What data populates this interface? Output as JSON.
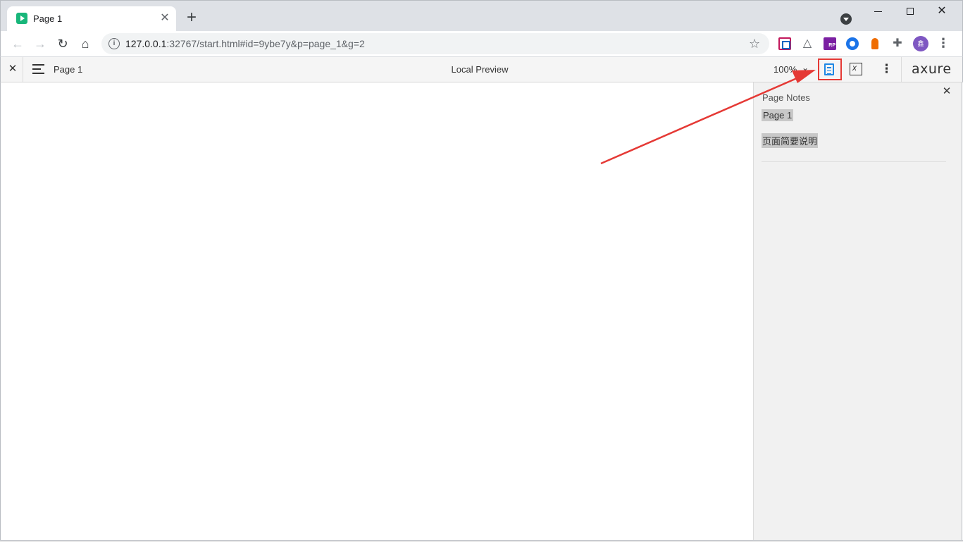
{
  "browser": {
    "tab": {
      "title": "Page 1",
      "close": "✕"
    },
    "new_tab": "+",
    "url": {
      "host": "127.0.0.1",
      "rest": ":32767/start.html#id=9ybe7y&p=page_1&g=2"
    },
    "window": {
      "close": "✕"
    },
    "avatar_initial": "鑫"
  },
  "axure": {
    "close": "✕",
    "page_name": "Page 1",
    "title": "Local Preview",
    "zoom": "100%",
    "logo": "axure"
  },
  "notes_panel": {
    "heading": "Page Notes",
    "page_name": "Page 1",
    "note_text": "页面简要说明",
    "close": "✕"
  },
  "colors": {
    "annotation": "#e53935",
    "notes_icon": "#1e88e5",
    "tab_favicon": "#18b67a"
  }
}
